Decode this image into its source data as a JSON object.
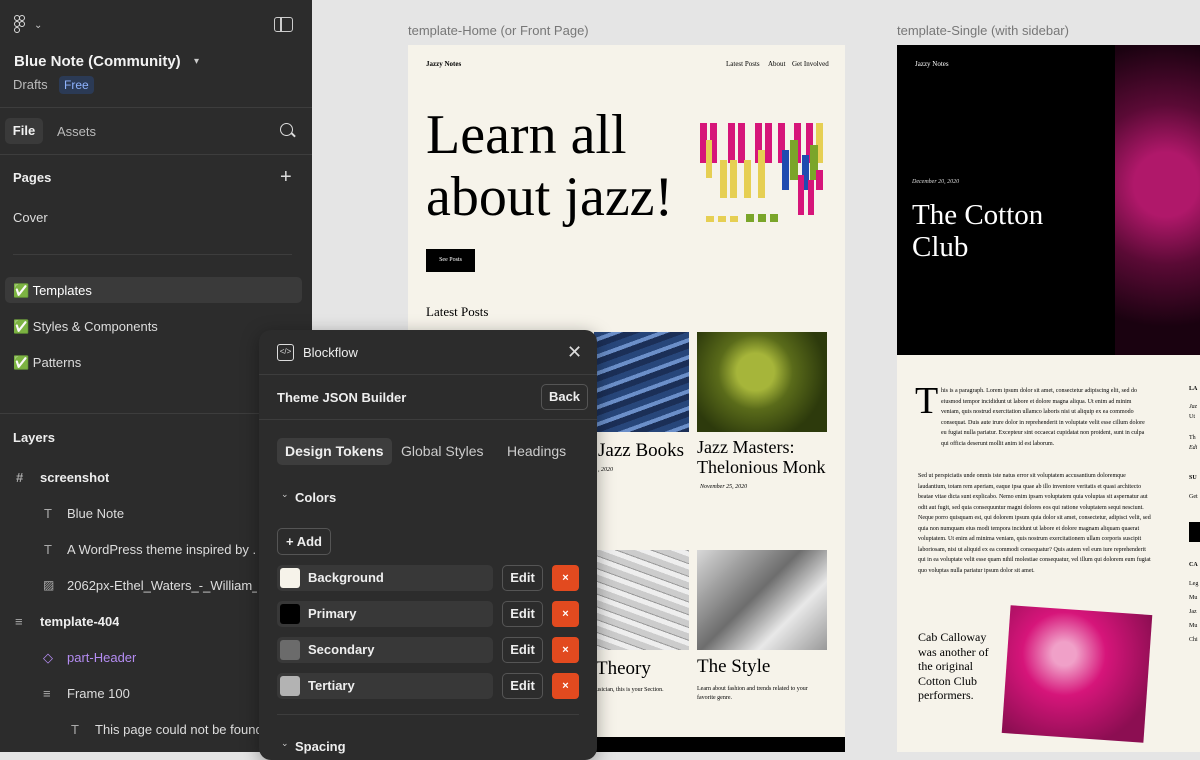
{
  "app": {
    "file_title": "Blue Note (Community)",
    "drafts_label": "Drafts",
    "plan_badge": "Free",
    "tabs": {
      "file": "File",
      "assets": "Assets"
    }
  },
  "pages": {
    "title": "Pages",
    "items": [
      {
        "label": "Cover"
      },
      {
        "label": "✅ Templates"
      },
      {
        "label": "✅ Styles & Components"
      },
      {
        "label": "✅ Patterns"
      }
    ]
  },
  "layers": {
    "title": "Layers",
    "items": [
      {
        "label": "screenshot",
        "icon": "frame-icon"
      },
      {
        "label": "Blue Note",
        "icon": "text-icon"
      },
      {
        "label": "A WordPress theme inspired by ...",
        "icon": "text-icon"
      },
      {
        "label": "2062px-Ethel_Waters_-_William_...",
        "icon": "image-icon"
      },
      {
        "label": "template-404",
        "icon": "auto-layout-icon"
      },
      {
        "label": "part-Header",
        "icon": "instance-icon"
      },
      {
        "label": "Frame 100",
        "icon": "auto-layout-icon"
      },
      {
        "label": "This page could not be found",
        "icon": "text-icon"
      }
    ]
  },
  "canvas": {
    "frame1": {
      "label": "template-Home (or Front Page)",
      "site_name": "Jazzy Notes",
      "nav": [
        "Latest Posts",
        "About",
        "Get Involved"
      ],
      "hero_title_line1": "Learn all",
      "hero_title_line2": "about jazz!",
      "cta": "See Posts",
      "section_title": "Latest Posts",
      "posts": [
        {
          "title": "Jazz Books",
          "date": ", 2020"
        },
        {
          "title_line1": "Jazz Masters:",
          "title_line2": "Thelonious Monk",
          "date": "November 25, 2020"
        },
        {
          "title": "Theory",
          "excerpt": "usician, this is your Section."
        },
        {
          "title": "The Style",
          "excerpt": "Learn about fashion and trends related to your favorite genre."
        }
      ]
    },
    "frame2": {
      "label": "template-Single (with sidebar)",
      "site_name": "Jazzy Notes",
      "date": "December 20, 2020",
      "title_line1": "The Cotton",
      "title_line2": "Club",
      "dropcap": "T",
      "para1": "his is a paragraph. Lorem ipsum dolor sit amet, consectetur adipiscing elit, sed do eiusmod tempor incididunt ut labore et dolore magna aliqua. Ut enim ad minim veniam, quis nostrud exercitation ullamco laboris nisi ut aliquip ex ea commodo consequat. Duis aute irure dolor in reprehenderit in voluptate velit esse cillum dolore eu fugiat nulla pariatur. Excepteur sint occaecat cupidatat non proident, sunt in culpa qui officia deserunt mollit anim id est laborum.",
      "para2": "Sed ut perspiciatis unde omnis iste natus error sit voluptatem accusantium doloremque laudantium, totam rem aperiam, eaque ipsa quae ab illo inventore veritatis et quasi architecto beatae vitae dicta sunt explicabo. Nemo enim ipsam voluptatem quia voluptas sit aspernatur aut odit aut fugit, sed quia consequuntur magni dolores eos qui ratione voluptatem sequi nesciunt. Neque porro quisquam est, qui dolorem ipsum quia dolor sit amet, consectetur, adipisci velit, sed quia non numquam eius modi tempora incidunt ut labore et dolore magnam aliquam quaerat voluptatem. Ut enim ad minima veniam, quis nostrum exercitationem ullam corporis suscipit laboriosam, nisi ut aliquid ex ea commodi consequatur? Quis autem vel eum iure reprehenderit qui in ea voluptate velit esse quam nihil molestiae consequatur, vel illum qui dolorem eum fugiat quo voluptas nulla pariatur ipsum dolor sit amet.",
      "caption": "Cab Calloway was another of the original Cotton Club performers.",
      "sidebar_fragments": [
        "LA",
        "Jaz",
        "Ut",
        "Th",
        "Edi",
        "SU",
        "Get",
        "CA",
        "Leg",
        "Mu",
        "Jaz",
        "Mu",
        "Chi"
      ]
    }
  },
  "plugin": {
    "name": "Blockflow",
    "section": "Theme JSON Builder",
    "back": "Back",
    "tabs": [
      "Design Tokens",
      "Global Styles",
      "Headings"
    ],
    "colors_heading": "Colors",
    "add_label": "+ Add",
    "edit_label": "Edit",
    "delete_label": "×",
    "colors": [
      {
        "name": "Background",
        "hex": "#f6f3ea"
      },
      {
        "name": "Primary",
        "hex": "#000000"
      },
      {
        "name": "Secondary",
        "hex": "#6b6b6b"
      },
      {
        "name": "Tertiary",
        "hex": "#b3b3b3"
      }
    ],
    "spacing_heading": "Spacing"
  },
  "colors": {
    "accent_pink": "#d6157a",
    "accent_yellow": "#e6cf53",
    "accent_green": "#7aa52a",
    "delete_red": "#e24a1f",
    "badge_blue": "#8fb3ff"
  }
}
